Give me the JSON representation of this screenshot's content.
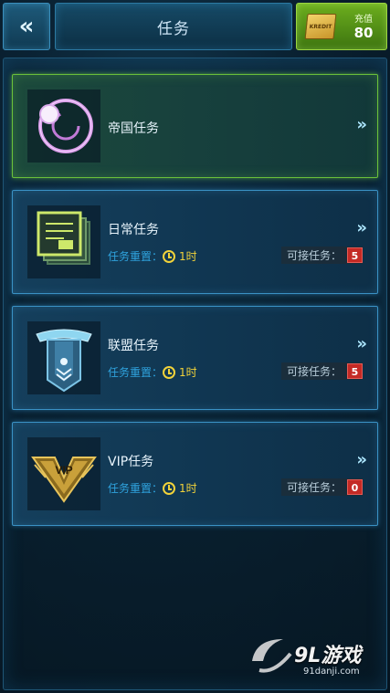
{
  "header": {
    "back_icon": "double-chevron-left-icon",
    "title": "任务",
    "recharge": {
      "card_text": "KREDIT",
      "label": "充值",
      "value": "80",
      "accent": "#6cae1e"
    }
  },
  "missions": [
    {
      "name": "帝国任务",
      "icon": "empire-orbit-icon",
      "featured": true,
      "accent": "#6bc13a"
    },
    {
      "name": "日常任务",
      "icon": "daily-document-icon",
      "reset_label": "任务重置：",
      "reset_time": "1时",
      "available_label": "可接任务：",
      "available_count": "5"
    },
    {
      "name": "联盟任务",
      "icon": "alliance-banner-icon",
      "reset_label": "任务重置：",
      "reset_time": "1时",
      "available_label": "可接任务：",
      "available_count": "5"
    },
    {
      "name": "VIP任务",
      "icon": "vip-emblem-icon",
      "reset_label": "任务重置：",
      "reset_time": "1时",
      "available_label": "可接任务：",
      "available_count": "0"
    }
  ],
  "chevron_icon": "double-chevron-right-icon",
  "watermark": {
    "brand": "9L游戏",
    "url": "91danji.com"
  },
  "colors": {
    "card_border": "#3a91c4",
    "reset_text": "#2fa3de",
    "clock": "#f1d23a",
    "badge": "#c42a25"
  }
}
